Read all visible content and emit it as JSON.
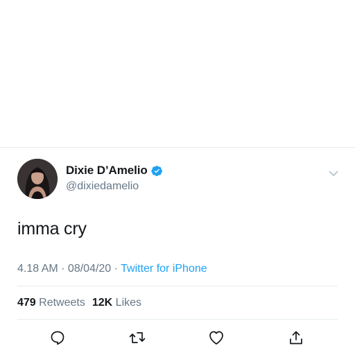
{
  "tweet": {
    "author": {
      "display_name": "Dixie D’Amelio",
      "handle": "@dixiedamelio",
      "verified": true
    },
    "text": "imma cry",
    "timestamp": "4.18 AM · 08/04/20",
    "meta_separator": " · ",
    "source": "Twitter for iPhone",
    "stats": {
      "retweets_count": "479",
      "retweets_label": "Retweets",
      "likes_count": "12K",
      "likes_label": "Likes"
    },
    "actions": {
      "reply_icon": "reply-icon",
      "retweet_icon": "retweet-icon",
      "like_icon": "heart-icon",
      "share_icon": "share-icon"
    },
    "colors": {
      "accent": "#1da1f2",
      "primary_text": "#14171a",
      "secondary_text": "#657786",
      "divider": "#e6ecf0"
    }
  }
}
